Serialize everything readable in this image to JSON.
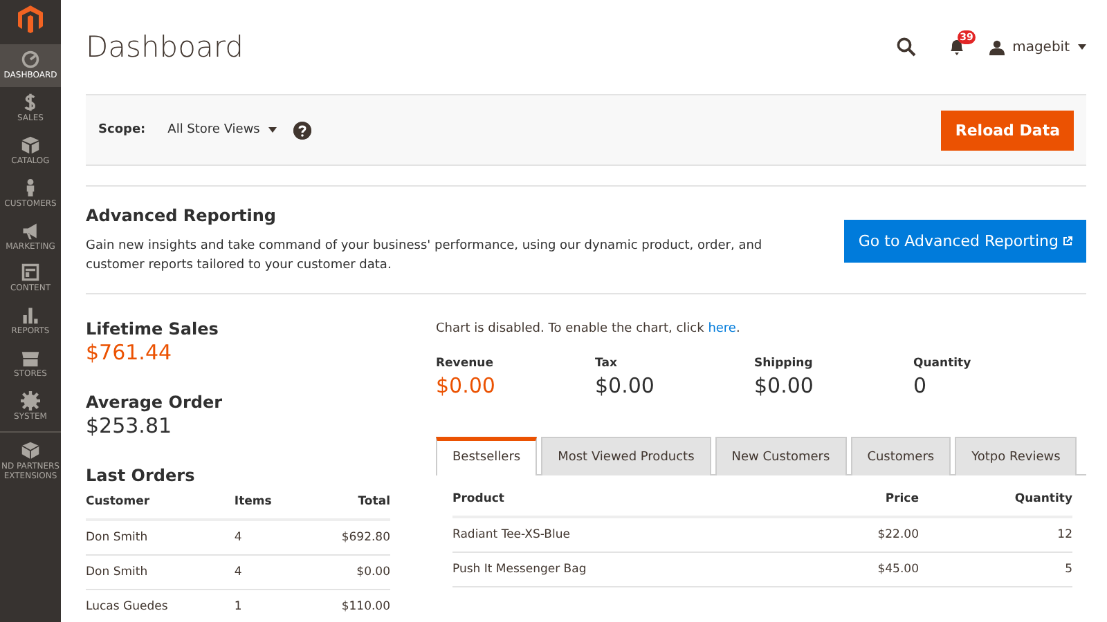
{
  "sidebar": {
    "items": [
      {
        "label": "DASHBOARD",
        "selected": true
      },
      {
        "label": "SALES",
        "selected": false
      },
      {
        "label": "CATALOG",
        "selected": false
      },
      {
        "label": "CUSTOMERS",
        "selected": false
      },
      {
        "label": "MARKETING",
        "selected": false
      },
      {
        "label": "CONTENT",
        "selected": false
      },
      {
        "label": "REPORTS",
        "selected": false
      },
      {
        "label": "STORES",
        "selected": false
      },
      {
        "label": "SYSTEM",
        "selected": false
      },
      {
        "label": "ND PARTNERS EXTENSIONS",
        "selected": false
      }
    ]
  },
  "header": {
    "title": "Dashboard",
    "notifications": "39",
    "user": "magebit"
  },
  "scope": {
    "label": "Scope:",
    "value": "All Store Views",
    "button": "Reload Data"
  },
  "advanced_reporting": {
    "title": "Advanced Reporting",
    "text": "Gain new insights and take command of your business' performance, using our dynamic product, order, and customer reports tailored to your customer data.",
    "button": "Go to Advanced Reporting"
  },
  "summary": [
    {
      "label": "Lifetime Sales",
      "value": "$761.44",
      "highlight": true
    },
    {
      "label": "Average Order",
      "value": "$253.81",
      "highlight": false
    }
  ],
  "last_orders": {
    "title": "Last Orders",
    "columns": [
      "Customer",
      "Items",
      "Total"
    ],
    "rows": [
      [
        "Don Smith",
        "4",
        "$692.80"
      ],
      [
        "Don Smith",
        "4",
        "$0.00"
      ],
      [
        "Lucas Guedes",
        "1",
        "$110.00"
      ]
    ]
  },
  "chart_notice": {
    "before": "Chart is disabled. To enable the chart, click",
    "link": "here",
    "after": "."
  },
  "totals": [
    {
      "label": "Revenue",
      "value": "$0.00",
      "highlight": true
    },
    {
      "label": "Tax",
      "value": "$0.00",
      "highlight": false
    },
    {
      "label": "Shipping",
      "value": "$0.00",
      "highlight": false
    },
    {
      "label": "Quantity",
      "value": "0",
      "highlight": false
    }
  ],
  "tabs": [
    {
      "label": "Bestsellers",
      "selected": true
    },
    {
      "label": "Most Viewed Products",
      "selected": false
    },
    {
      "label": "New Customers",
      "selected": false
    },
    {
      "label": "Customers",
      "selected": false
    },
    {
      "label": "Yotpo Reviews",
      "selected": false
    }
  ],
  "bestsellers": {
    "columns": [
      "Product",
      "Price",
      "Quantity"
    ],
    "rows": [
      [
        "Radiant Tee-XS-Blue",
        "$22.00",
        "12"
      ],
      [
        "Push It Messenger Bag",
        "$45.00",
        "5"
      ]
    ]
  }
}
